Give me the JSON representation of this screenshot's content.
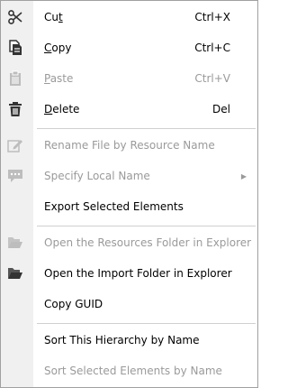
{
  "menu": {
    "items": [
      {
        "label_pre": "Cu",
        "label_ul": "t",
        "label_post": "",
        "shortcut": "Ctrl+X",
        "icon": "scissors-icon",
        "disabled": false
      },
      {
        "label_pre": "",
        "label_ul": "C",
        "label_post": "opy",
        "shortcut": "Ctrl+C",
        "icon": "copy-icon",
        "disabled": false
      },
      {
        "label_pre": "",
        "label_ul": "P",
        "label_post": "aste",
        "shortcut": "Ctrl+V",
        "icon": "paste-icon",
        "disabled": true
      },
      {
        "label_pre": "",
        "label_ul": "D",
        "label_post": "elete",
        "shortcut": "Del",
        "icon": "trash-icon",
        "disabled": false
      },
      {
        "label": "Rename File by Resource Name",
        "icon": "rename-icon",
        "disabled": true
      },
      {
        "label": "Specify Local Name",
        "icon": "comment-icon",
        "disabled": true,
        "submenu": true
      },
      {
        "label": "Export Selected Elements",
        "disabled": false
      },
      {
        "label": "Open the Resources Folder in Explorer",
        "icon": "folder-open-icon",
        "disabled": true
      },
      {
        "label": "Open the Import Folder in Explorer",
        "icon": "folder-open-icon",
        "disabled": false
      },
      {
        "label": "Copy GUID",
        "disabled": false
      },
      {
        "label": "Sort This Hierarchy by Name",
        "disabled": false
      },
      {
        "label": "Sort Selected Elements by Name",
        "disabled": true
      }
    ]
  },
  "colors": {
    "enabled_text": "#000000",
    "disabled_text": "#9a9a9a",
    "gutter": "#f0f0f0",
    "separator": "#d0d0d0"
  }
}
